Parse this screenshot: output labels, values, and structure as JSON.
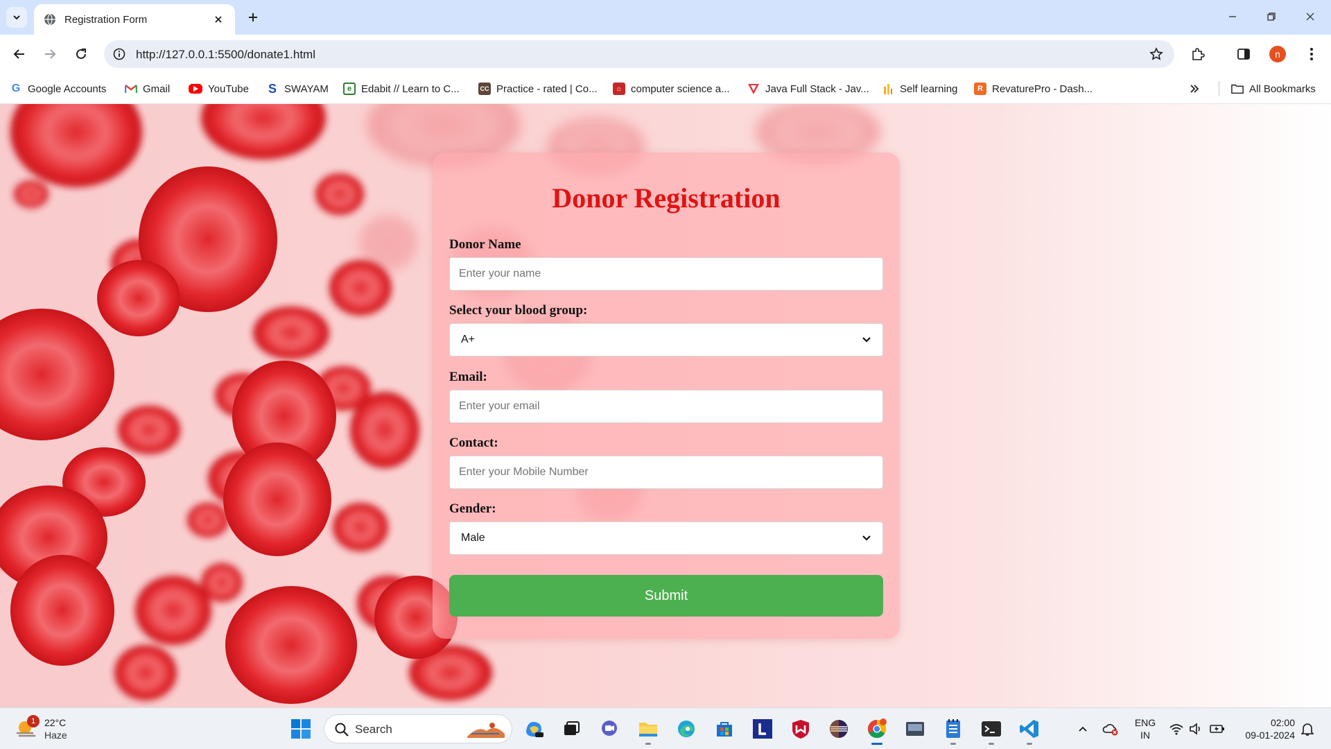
{
  "browser": {
    "tab_title": "Registration Form",
    "url": "http://127.0.0.1:5500/donate1.html",
    "profile_initial": "n"
  },
  "bookmarks": [
    {
      "label": "Google Accounts",
      "icon": "google-icon"
    },
    {
      "label": "Gmail",
      "icon": "gmail-icon"
    },
    {
      "label": "YouTube",
      "icon": "youtube-icon"
    },
    {
      "label": "SWAYAM",
      "icon": "swayam-icon"
    },
    {
      "label": "Edabit // Learn to C...",
      "icon": "edabit-icon"
    },
    {
      "label": "Practice - rated | Co...",
      "icon": "codechef-icon"
    },
    {
      "label": "computer science a...",
      "icon": "university-icon"
    },
    {
      "label": "Java Full Stack - Jav...",
      "icon": "java-course-icon"
    },
    {
      "label": "Self learning",
      "icon": "self-learning-icon"
    },
    {
      "label": "RevaturePro - Dash...",
      "icon": "revature-icon"
    }
  ],
  "bookmarks_all_label": "All Bookmarks",
  "form": {
    "title": "Donor Registration",
    "name_label": "Donor Name",
    "name_placeholder": "Enter your name",
    "blood_label": "Select your blood group:",
    "blood_value": "A+",
    "email_label": "Email:",
    "email_placeholder": "Enter your email",
    "contact_label": "Contact:",
    "contact_placeholder": "Enter your Mobile Number",
    "gender_label": "Gender:",
    "gender_value": "Male",
    "submit_label": "Submit"
  },
  "taskbar": {
    "weather_temp": "22°C",
    "weather_condition": "Haze",
    "weather_badge": "1",
    "search_label": "Search",
    "language_top": "ENG",
    "language_bottom": "IN",
    "time": "02:00",
    "date": "09-01-2024"
  },
  "colors": {
    "title_red": "#e01313",
    "submit_green": "#4caf50",
    "card_pink": "#ffaaac"
  }
}
